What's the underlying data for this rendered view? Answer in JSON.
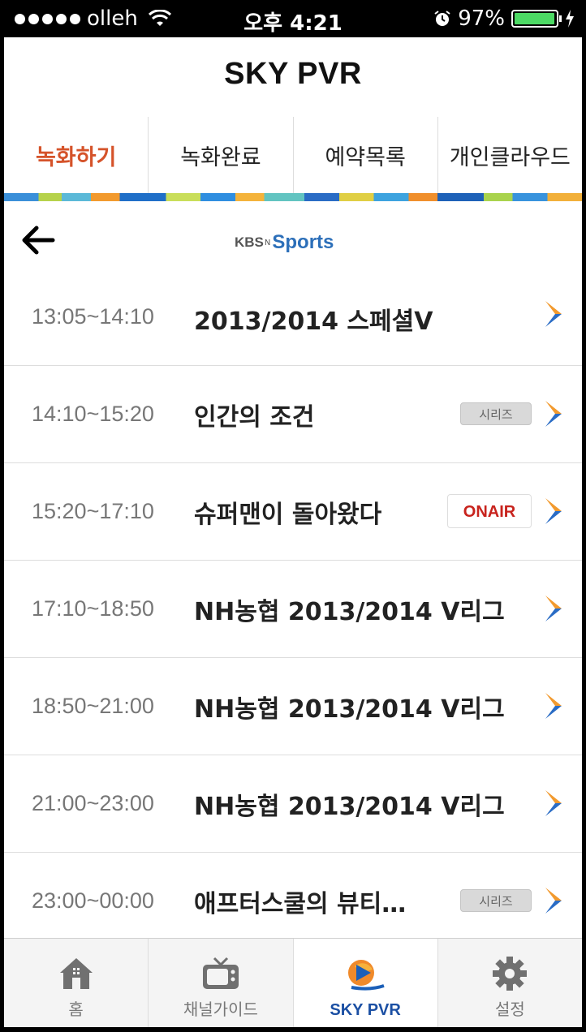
{
  "statusbar": {
    "carrier": "olleh",
    "time": "오후 4:21",
    "battery": "97%"
  },
  "header": {
    "title": "SKY PVR"
  },
  "tabs": [
    {
      "label": "녹화하기"
    },
    {
      "label": "녹화완료"
    },
    {
      "label": "예약목록"
    },
    {
      "label": "개인클라우드"
    }
  ],
  "channel": {
    "logo_kbs": "KBS",
    "logo_n": "N",
    "logo_sports": "Sports"
  },
  "programs": [
    {
      "time": "13:05~14:10",
      "title": "2013/2014 스페셜V",
      "badge": ""
    },
    {
      "time": "14:10~15:20",
      "title": "인간의 조건",
      "badge": "시리즈"
    },
    {
      "time": "15:20~17:10",
      "title": "슈퍼맨이 돌아왔다",
      "badge": "ONAIR"
    },
    {
      "time": "17:10~18:50",
      "title": "NH농협 2013/2014 V리그",
      "badge": ""
    },
    {
      "time": "18:50~21:00",
      "title": "NH농협 2013/2014 V리그",
      "badge": ""
    },
    {
      "time": "21:00~23:00",
      "title": "NH농협 2013/2014 V리그",
      "badge": ""
    },
    {
      "time": "23:00~00:00",
      "title": "애프터스쿨의 뷰티…",
      "badge": "시리즈"
    }
  ],
  "tabbar": [
    {
      "label": "홈",
      "icon": "home-icon"
    },
    {
      "label": "채널가이드",
      "icon": "tv-icon"
    },
    {
      "label": "SKY PVR",
      "icon": "pvr-logo-icon"
    },
    {
      "label": "설정",
      "icon": "gear-icon"
    }
  ],
  "colors": {
    "active_tab": "#d5532a",
    "active_bottom": "#1b4fa3",
    "onair": "#c8231d",
    "chevron_blue": "#2a6cc5",
    "chevron_orange": "#f29a2e"
  }
}
